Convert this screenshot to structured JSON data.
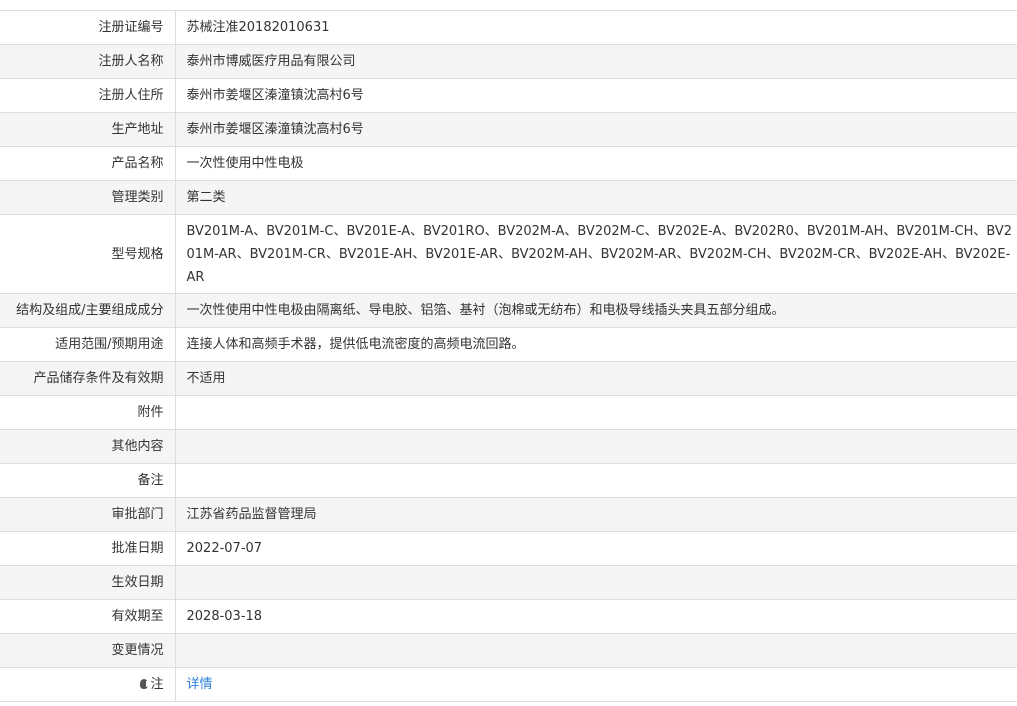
{
  "rows": [
    {
      "label": "注册证编号",
      "value": "苏械注准20182010631"
    },
    {
      "label": "注册人名称",
      "value": "泰州市博威医疗用品有限公司"
    },
    {
      "label": "注册人住所",
      "value": "泰州市姜堰区溱潼镇沈高村6号"
    },
    {
      "label": "生产地址",
      "value": "泰州市姜堰区溱潼镇沈高村6号"
    },
    {
      "label": "产品名称",
      "value": "一次性使用中性电极"
    },
    {
      "label": "管理类别",
      "value": "第二类"
    },
    {
      "label": "型号规格",
      "value": "BV201M-A、BV201M-C、BV201E-A、BV201RO、BV202M-A、BV202M-C、BV202E-A、BV202R0、BV201M-AH、BV201M-CH、BV201M-AR、BV201M-CR、BV201E-AH、BV201E-AR、BV202M-AH、BV202M-AR、BV202M-CH、BV202M-CR、BV202E-AH、BV202E-AR"
    },
    {
      "label": "结构及组成/主要组成成分",
      "value": "一次性使用中性电极由隔离纸、导电胶、铝箔、基衬（泡棉或无纺布）和电极导线插头夹具五部分组成。"
    },
    {
      "label": "适用范围/预期用途",
      "value": "连接人体和高频手术器，提供低电流密度的高频电流回路。"
    },
    {
      "label": "产品储存条件及有效期",
      "value": "不适用"
    },
    {
      "label": "附件",
      "value": ""
    },
    {
      "label": "其他内容",
      "value": ""
    },
    {
      "label": "备注",
      "value": ""
    },
    {
      "label": "审批部门",
      "value": "江苏省药品监督管理局"
    },
    {
      "label": "批准日期",
      "value": "2022-07-07"
    },
    {
      "label": "生效日期",
      "value": ""
    },
    {
      "label": "有效期至",
      "value": "2028-03-18"
    },
    {
      "label": "变更情况",
      "value": ""
    }
  ],
  "note_row": {
    "icon": "note-icon",
    "label": "注",
    "link_text": "详情",
    "link_color": "#2a7ed8"
  }
}
